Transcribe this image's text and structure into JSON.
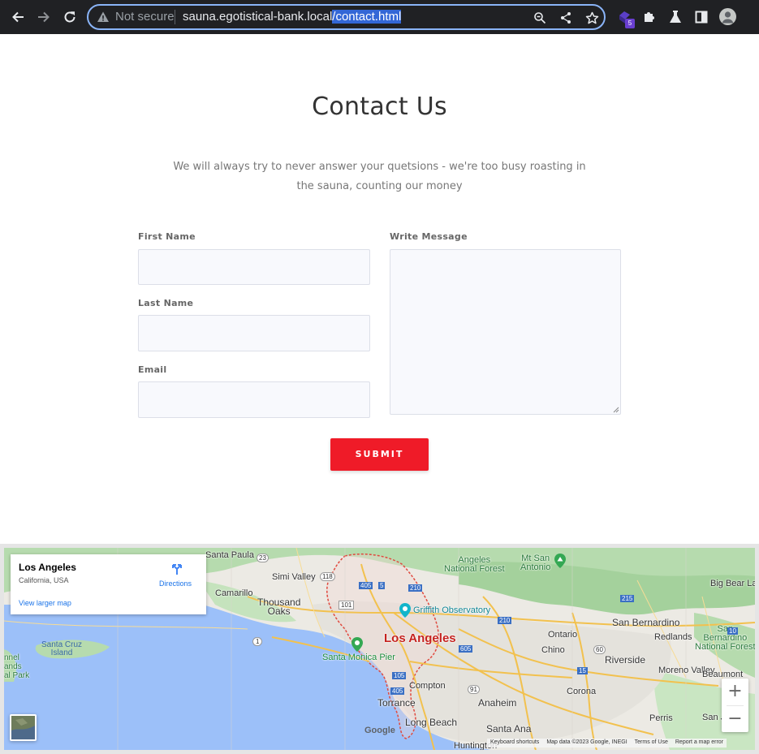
{
  "browser": {
    "security_label": "Not secure",
    "url_host": "sauna.egotistical-bank.local",
    "url_path": "/contact.html",
    "extension_badge": "5"
  },
  "page": {
    "title": "Contact Us",
    "subtitle": "We will always try to never answer your quetsions - we're too busy roasting in the sauna, counting our money"
  },
  "form": {
    "first_name_label": "First Name",
    "first_name_value": "",
    "last_name_label": "Last Name",
    "last_name_value": "",
    "email_label": "Email",
    "email_value": "",
    "message_label": "Write Message",
    "message_value": "",
    "submit_label": "SUBMIT"
  },
  "map": {
    "place_title": "Los Angeles",
    "place_subtitle": "California, USA",
    "directions_label": "Directions",
    "view_larger_label": "View larger map",
    "zoom_in_label": "+",
    "zoom_out_label": "−",
    "google_logo": "Google",
    "attribution": {
      "shortcuts": "Keyboard shortcuts",
      "map_data": "Map data ©2023 Google, INEGI",
      "terms": "Terms of Use",
      "report": "Report a map error"
    },
    "labels": {
      "santa_paula": "Santa Paula",
      "simi_valley": "Simi Valley",
      "camarillo": "Camarillo",
      "thousand_oaks": "Thousand\nOaks",
      "angeles_nf": "Angeles\nNational Forest",
      "mt_san_antonio": "Mt San\nAntonio",
      "big_bear_lake": "Big Bear Lake",
      "griffith": "Griffith Observatory",
      "los_angeles": "Los Angeles",
      "santa_monica_pier": "Santa Monica Pier",
      "san_bernardino": "San Bernardino",
      "ontario": "Ontario",
      "redlands": "Redlands",
      "san_bernardino_nf": "San\nBernardino\nNational Forest",
      "chino": "Chino",
      "riverside": "Riverside",
      "moreno_valley": "Moreno Valley",
      "beaumont": "Beaumont",
      "santa_cruz_island": "Santa Cruz\nIsland",
      "channel_islands": "nnel\nands\nal Park",
      "compton": "Compton",
      "torrance": "Torrance",
      "anaheim": "Anaheim",
      "corona": "Corona",
      "long_beach": "Long Beach",
      "santa_ana": "Santa Ana",
      "perris": "Perris",
      "san_j": "San J",
      "huntington": "Huntington",
      "hwy_23": "23",
      "hwy_118": "118",
      "hwy_405a": "405",
      "hwy_5": "5",
      "hwy_210a": "210",
      "hwy_101": "101",
      "hwy_1": "1",
      "hwy_215": "215",
      "hwy_210b": "210",
      "hwy_605": "605",
      "hwy_60": "60",
      "hwy_15": "15",
      "hwy_91": "91",
      "hwy_105": "105",
      "hwy_405b": "405",
      "hwy_10": "10"
    }
  },
  "colors": {
    "accent_red": "#ef1b28",
    "chrome_bg": "#202124",
    "focus_ring": "#8ab4f8",
    "url_selection": "#3367d6",
    "map_water": "#9cc0f9",
    "map_land": "#e8eaed",
    "map_park": "#a8d5a2",
    "map_city_border": "#e04a3f"
  },
  "icons": [
    "back-arrow-icon",
    "forward-arrow-icon",
    "reload-icon",
    "warning-triangle-icon",
    "zoom-icon",
    "share-icon",
    "star-icon",
    "extension-badge-icon",
    "puzzle-icon",
    "flask-icon",
    "side-panel-icon",
    "profile-avatar-icon",
    "directions-icon"
  ]
}
